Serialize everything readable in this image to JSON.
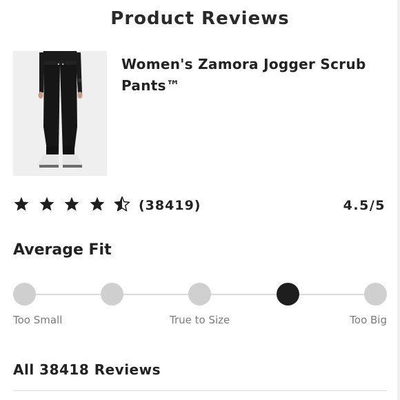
{
  "header": {
    "title": "Product Reviews"
  },
  "product": {
    "name": "Women's Zamora Jogger Scrub Pants™",
    "image_icon": "product-photo-jogger-pants"
  },
  "rating": {
    "stars": 4.5,
    "count_text": "(38419)",
    "score_text": "4.5/5",
    "star_color": "#1e1e1e"
  },
  "fit": {
    "heading": "Average Fit",
    "options_count": 5,
    "selected_index": 3,
    "labels": {
      "low": "Too Small",
      "mid": "True to Size",
      "high": "Too Big"
    },
    "dot_color": "#cfcfcf",
    "selected_color": "#1e1e1e"
  },
  "reviews": {
    "all_label": "All 38418 Reviews"
  }
}
